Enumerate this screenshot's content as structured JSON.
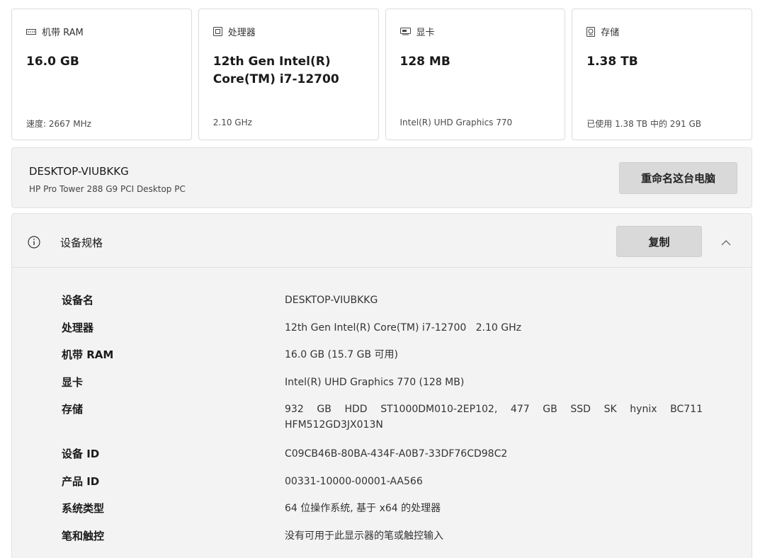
{
  "cards": [
    {
      "icon": "memory-icon",
      "label": "机带 RAM",
      "value": "16.0 GB",
      "sub": "速度: 2667 MHz"
    },
    {
      "icon": "processor-icon",
      "label": "处理器",
      "value": "12th Gen Intel(R) Core(TM) i7-12700",
      "sub": "2.10 GHz"
    },
    {
      "icon": "graphics-card-icon",
      "label": "显卡",
      "value": "128 MB",
      "sub": "Intel(R) UHD Graphics 770"
    },
    {
      "icon": "storage-icon",
      "label": "存储",
      "value": "1.38 TB",
      "sub": "已使用 1.38 TB 中的 291 GB"
    }
  ],
  "device": {
    "name": "DESKTOP-VIUBKKG",
    "model": "HP Pro Tower 288 G9 PCI Desktop PC",
    "rename_label": "重命名这台电脑"
  },
  "specs": {
    "title": "设备规格",
    "copy_label": "复制",
    "rows": [
      {
        "label": "设备名",
        "value": "DESKTOP-VIUBKKG"
      },
      {
        "label": "处理器",
        "value": "12th Gen Intel(R) Core(TM) i7-12700   2.10 GHz"
      },
      {
        "label": "机带 RAM",
        "value": "16.0 GB (15.7 GB 可用)"
      },
      {
        "label": "显卡",
        "value": "Intel(R) UHD Graphics 770 (128 MB)"
      },
      {
        "label": "存储",
        "value": "932 GB HDD ST1000DM010-2EP102, 477 GB SSD SK hynix BC711 HFM512GD3JX013N"
      },
      {
        "label": "设备 ID",
        "value": "C09CB46B-80BA-434F-A0B7-33DF76CD98C2"
      },
      {
        "label": "产品 ID",
        "value": "00331-10000-00001-AA566"
      },
      {
        "label": "系统类型",
        "value": "64 位操作系统, 基于 x64 的处理器"
      },
      {
        "label": "笔和触控",
        "value": "没有可用于此显示器的笔或触控输入"
      }
    ]
  }
}
